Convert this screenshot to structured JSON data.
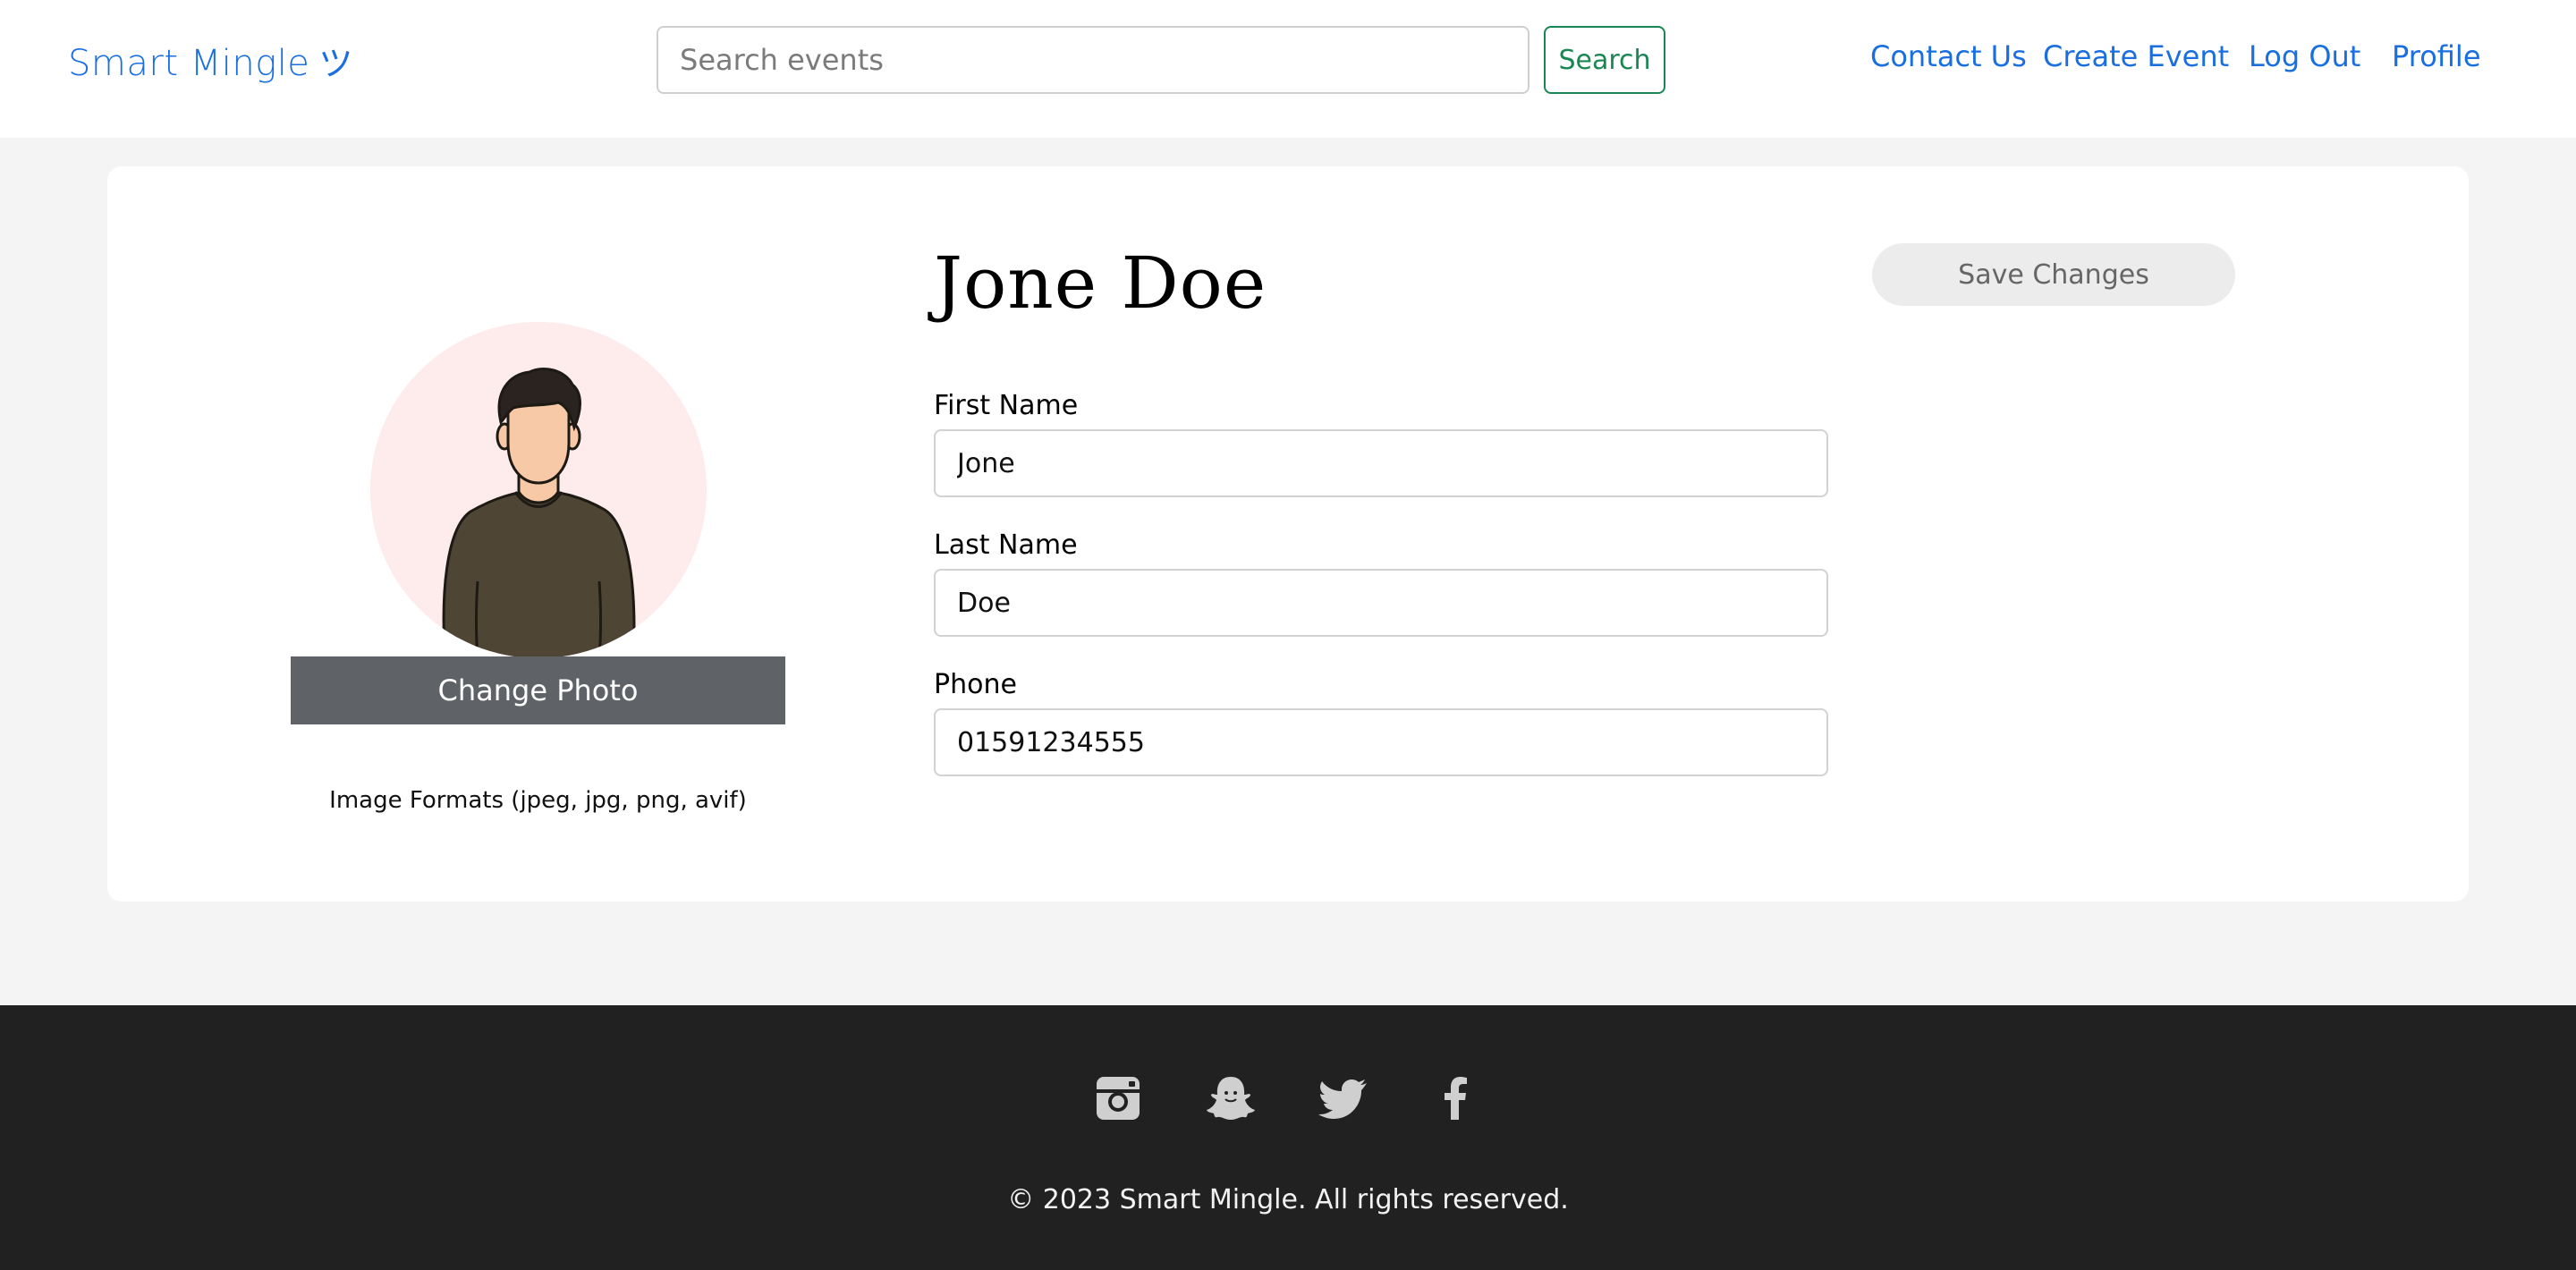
{
  "header": {
    "brand": "Smart Mingle",
    "brand_emoji": "ツ",
    "search": {
      "placeholder": "Search events",
      "value": "",
      "button_label": "Search"
    },
    "nav": {
      "contact": "Contact Us",
      "create_event": "Create Event",
      "logout": "Log Out",
      "profile": "Profile"
    }
  },
  "profile": {
    "name": "Jone Doe",
    "change_photo_label": "Change Photo",
    "image_formats_note": "Image Formats (jpeg, jpg, png, avif)",
    "save_button_label": "Save Changes",
    "fields": {
      "first_name": {
        "label": "First Name",
        "value": "Jone"
      },
      "last_name": {
        "label": "Last Name",
        "value": "Doe"
      },
      "phone": {
        "label": "Phone",
        "value": "01591234555"
      }
    }
  },
  "footer": {
    "social_icons": [
      "instagram-icon",
      "snapchat-icon",
      "twitter-icon",
      "facebook-icon"
    ],
    "copyright": "© 2023 Smart Mingle. All rights reserved."
  },
  "colors": {
    "link_blue": "#1a6fe0",
    "search_green": "#198754",
    "change_photo_bg": "#5f6367",
    "footer_bg": "#212121",
    "avatar_bg": "#fdeceb",
    "page_bg": "#f4f4f4"
  }
}
